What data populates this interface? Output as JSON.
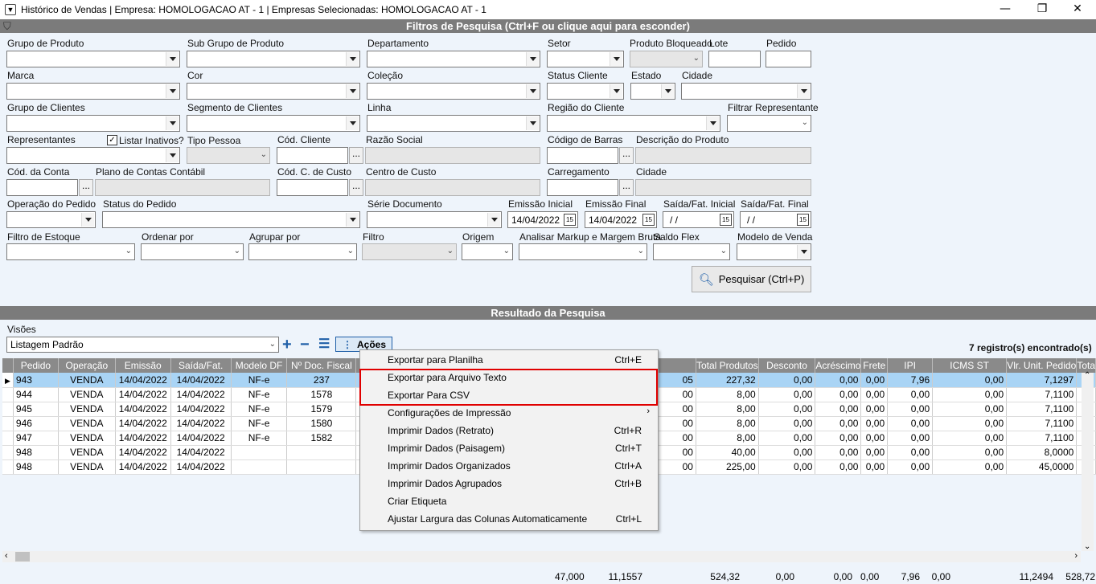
{
  "window": {
    "title": "Histórico de Vendas | Empresa: HOMOLOGACAO AT - 1 | Empresas Selecionadas: HOMOLOGACAO AT - 1",
    "minimize": "—",
    "maximize": "❐",
    "close": "✕"
  },
  "filters": {
    "header": "Filtros de Pesquisa (Ctrl+F ou clique aqui para esconder)",
    "grupo_produto": "Grupo de Produto",
    "sub_grupo": "Sub Grupo de Produto",
    "departamento": "Departamento",
    "setor": "Setor",
    "produto_bloqueado": "Produto Bloqueado",
    "lote": "Lote",
    "pedido": "Pedido",
    "marca": "Marca",
    "cor": "Cor",
    "colecao": "Coleção",
    "status_cliente": "Status Cliente",
    "estado": "Estado",
    "cidade": "Cidade",
    "grupo_clientes": "Grupo de Clientes",
    "segmento_clientes": "Segmento de Clientes",
    "linha": "Linha",
    "regiao_cliente": "Região do Cliente",
    "filtrar_representante": "Filtrar Representante",
    "representantes": "Representantes",
    "listar_inativos": "Listar Inativos?",
    "tipo_pessoa": "Tipo Pessoa",
    "cod_cliente": "Cód. Cliente",
    "razao_social": "Razão Social",
    "codigo_barras": "Código de Barras",
    "descricao_produto": "Descrição do Produto",
    "cod_conta": "Cód. da Conta",
    "plano_contas": "Plano de Contas Contábil",
    "cod_centro_custo": "Cód. C. de Custo",
    "centro_custo": "Centro de Custo",
    "carregamento": "Carregamento",
    "cidade2": "Cidade",
    "operacao_pedido": "Operação do Pedido",
    "status_pedido": "Status do Pedido",
    "serie_documento": "Série Documento",
    "emissao_inicial": "Emissão Inicial",
    "emissao_final": "Emissão Final",
    "saida_inicial": "Saída/Fat. Inicial",
    "saida_final": "Saída/Fat. Final",
    "emissao_inicial_val": "14/04/2022",
    "emissao_final_val": "14/04/2022",
    "saida_inicial_val": " / /",
    "saida_final_val": " / /",
    "filtro_estoque": "Filtro de Estoque",
    "ordenar_por": "Ordenar por",
    "agrupar_por": "Agrupar por",
    "filtro": "Filtro",
    "origem": "Origem",
    "analisar_markup": "Analisar Markup e Margem Bruta",
    "saldo_flex": "Saldo Flex",
    "modelo_venda": "Modelo de Venda",
    "pesquisar": "Pesquisar (Ctrl+P)",
    "ellipsis": "...",
    "cal_icon": "15"
  },
  "results": {
    "header": "Resultado da Pesquisa",
    "visoes": "Visões",
    "visao_val": "Listagem Padrão",
    "acoes": "Ações",
    "count": "7 registro(s) encontrado(s)",
    "columns": [
      "Pedido",
      "Operação",
      "Emissão",
      "Saída/Fat.",
      "Modelo DF",
      "Nº Doc. Fiscal",
      "",
      "",
      "Total Produtos",
      "Desconto",
      "Acréscimo",
      "Frete",
      "IPI",
      "ICMS ST",
      "Vlr. Unit. Pedido",
      "Tota"
    ],
    "rows": [
      [
        "943",
        "VENDA",
        "14/04/2022",
        "14/04/2022",
        "NF-e",
        "237",
        "",
        "05",
        "227,32",
        "0,00",
        "0,00",
        "0,00",
        "7,96",
        "0,00",
        "7,1297",
        ""
      ],
      [
        "944",
        "VENDA",
        "14/04/2022",
        "14/04/2022",
        "NF-e",
        "1578",
        "",
        "00",
        "8,00",
        "0,00",
        "0,00",
        "0,00",
        "0,00",
        "0,00",
        "7,1100",
        ""
      ],
      [
        "945",
        "VENDA",
        "14/04/2022",
        "14/04/2022",
        "NF-e",
        "1579",
        "",
        "00",
        "8,00",
        "0,00",
        "0,00",
        "0,00",
        "0,00",
        "0,00",
        "7,1100",
        ""
      ],
      [
        "946",
        "VENDA",
        "14/04/2022",
        "14/04/2022",
        "NF-e",
        "1580",
        "",
        "00",
        "8,00",
        "0,00",
        "0,00",
        "0,00",
        "0,00",
        "0,00",
        "7,1100",
        ""
      ],
      [
        "947",
        "VENDA",
        "14/04/2022",
        "14/04/2022",
        "NF-e",
        "1582",
        "",
        "00",
        "8,00",
        "0,00",
        "0,00",
        "0,00",
        "0,00",
        "0,00",
        "7,1100",
        ""
      ],
      [
        "948",
        "VENDA",
        "14/04/2022",
        "14/04/2022",
        "",
        "",
        "",
        "00",
        "40,00",
        "0,00",
        "0,00",
        "0,00",
        "0,00",
        "0,00",
        "8,0000",
        ""
      ],
      [
        "948",
        "VENDA",
        "14/04/2022",
        "14/04/2022",
        "",
        "",
        "",
        "00",
        "225,00",
        "0,00",
        "0,00",
        "0,00",
        "0,00",
        "0,00",
        "45,0000",
        ""
      ]
    ],
    "totals": [
      "47,000",
      "11,1557",
      "524,32",
      "0,00",
      "0,00",
      "0,00",
      "7,96",
      "0,00",
      "11,2494",
      "528,72"
    ]
  },
  "menu": [
    {
      "label": "Exportar para Planilha",
      "shortcut": "Ctrl+E"
    },
    {
      "label": "Exportar para Arquivo Texto",
      "shortcut": ""
    },
    {
      "label": "Exportar Para CSV",
      "shortcut": ""
    },
    {
      "label": "Configurações de Impressão",
      "shortcut": "",
      "arrow": "›"
    },
    {
      "label": "Imprimir Dados (Retrato)",
      "shortcut": "Ctrl+R"
    },
    {
      "label": "Imprimir Dados (Paisagem)",
      "shortcut": "Ctrl+T"
    },
    {
      "label": "Imprimir Dados Organizados",
      "shortcut": "Ctrl+A"
    },
    {
      "label": "Imprimir Dados Agrupados",
      "shortcut": "Ctrl+B"
    },
    {
      "label": "Criar Etiqueta",
      "shortcut": ""
    },
    {
      "label": "Ajustar Largura das Colunas Automaticamente",
      "shortcut": "Ctrl+L"
    }
  ]
}
